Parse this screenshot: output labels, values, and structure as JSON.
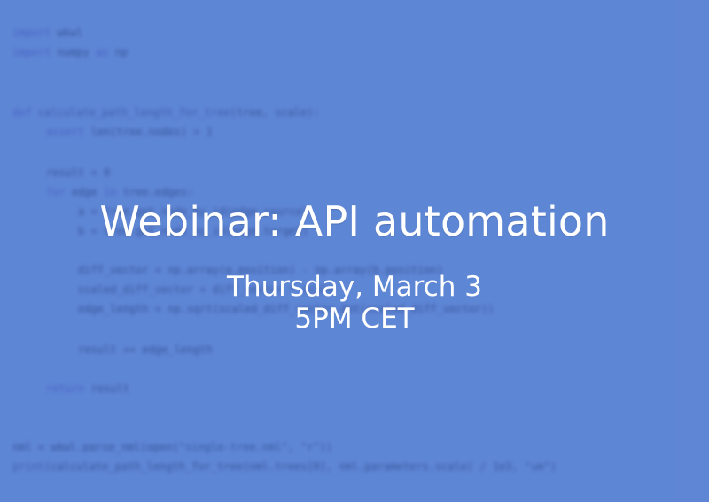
{
  "event": {
    "title": "Webinar: API automation",
    "date": "Thursday, March 3",
    "time": "5PM CET"
  },
  "colors": {
    "background": "#5f86d4",
    "text": "#ffffff"
  }
}
